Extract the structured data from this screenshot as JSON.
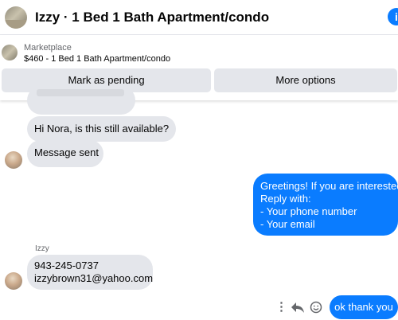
{
  "header": {
    "title": "Izzy · 1 Bed 1 Bath Apartment/condo",
    "info_glyph": "i",
    "accent": "#0a7cff"
  },
  "listing": {
    "source": "Marketplace",
    "description": "$460 - 1 Bed 1 Bath Apartment/condo",
    "pending_label": "Mark as pending",
    "more_label": "More options"
  },
  "messages": {
    "incoming_1": "Hi Nora, is this still available?",
    "incoming_2": "Message sent",
    "outgoing_lines": [
      "Greetings! If you are interested",
      "Reply with:",
      "- Your phone number",
      "- Your email"
    ],
    "sender_name": "Izzy",
    "contact_lines": [
      "943-245-0737",
      " izzybrown31@yahoo.com"
    ],
    "outgoing_last": "ok thank you"
  },
  "actions": {
    "more_glyph": "⋮"
  },
  "icons": {
    "info": "info-icon",
    "more": "more-vertical-icon",
    "reply": "reply-icon",
    "emoji": "emoji-icon"
  },
  "colors": {
    "outgoing_bubble": "#0a7cff",
    "incoming_bubble": "#e4e6eb",
    "button_bg": "#e4e6eb",
    "secondary_text": "#65676b"
  }
}
